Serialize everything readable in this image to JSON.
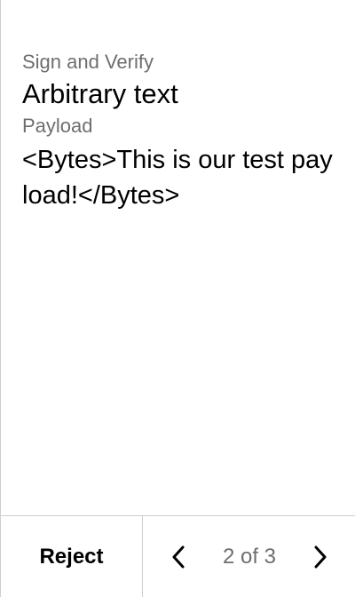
{
  "review": {
    "section_label": "Sign and Verify",
    "title": "Arbitrary text",
    "payload_label": "Payload",
    "payload_value": "<Bytes>This is our test payload!</Bytes>"
  },
  "footer": {
    "reject_label": "Reject",
    "page_indicator": "2 of 3",
    "prev_icon": "chevron-left-icon",
    "next_icon": "chevron-right-icon"
  }
}
